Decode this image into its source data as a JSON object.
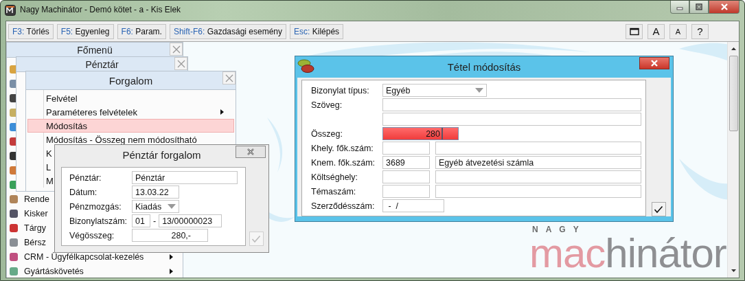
{
  "window": {
    "title": "Nagy Machinátor - Demó kötet - a - Kis Elek"
  },
  "toolbar": {
    "commands": [
      {
        "key": "F3:",
        "label": "Törlés"
      },
      {
        "key": "F5:",
        "label": "Egyenleg"
      },
      {
        "key": "F6:",
        "label": "Param."
      },
      {
        "key": "Shift-F6:",
        "label": "Gazdasági esemény"
      },
      {
        "key": "Esc:",
        "label": "Kilépés"
      }
    ],
    "view_buttons": [
      {
        "kind": "window"
      },
      {
        "kind": "large",
        "label": "A"
      },
      {
        "kind": "small",
        "label": "A"
      },
      {
        "kind": "large",
        "label": "?"
      }
    ]
  },
  "main_menu": {
    "title": "Főmenü",
    "items": [
      {
        "label": "Rende"
      },
      {
        "label": "Kisker"
      },
      {
        "label": "Tárgy"
      },
      {
        "label": "Bérsz"
      },
      {
        "label": "CRM - Ügyfélkapcsolat-kezelés",
        "has_submenu": true
      },
      {
        "label": "Gyártáskövetés",
        "has_submenu": true
      }
    ]
  },
  "cash_menu": {
    "title": "Pénztár"
  },
  "transactions_menu": {
    "title": "Forgalom",
    "items": [
      {
        "label": "Felvétel",
        "has_submenu": false,
        "selected": false
      },
      {
        "label": "Paraméteres felvételek",
        "has_submenu": true,
        "selected": false
      },
      {
        "label": "Módosítás",
        "has_submenu": false,
        "selected": true
      },
      {
        "label": "Módosítás - Összeg nem módosítható",
        "has_submenu": false,
        "selected": false
      },
      {
        "label": "K",
        "selected": false
      },
      {
        "label": "L",
        "selected": false
      },
      {
        "label": "M",
        "selected": false
      }
    ]
  },
  "cash_dialog": {
    "title": "Pénztár forgalom",
    "ok_disabled": true,
    "fields": [
      {
        "label": "Pénztár:",
        "kind": "text",
        "value": "Pénztár"
      },
      {
        "label": "Dátum:",
        "kind": "date",
        "value": "13.03.22"
      },
      {
        "label": "Pénzmozgás:",
        "kind": "combo",
        "value": "Kiadás"
      },
      {
        "label": "Bizonylatszám:",
        "kind": "pair",
        "value": "01",
        "separator": "-",
        "second": "13/00000023"
      },
      {
        "label": "Végösszeg:",
        "kind": "amount",
        "value": "280,-"
      }
    ]
  },
  "item_dialog": {
    "title": "Tétel módosítás",
    "ok_disabled": false,
    "fields": [
      {
        "label": "Bizonylat típus:",
        "kind": "combo",
        "value": "Egyéb",
        "invalid": false
      },
      {
        "label": "Szöveg:",
        "kind": "wide",
        "invalid": false
      },
      {
        "kind": "wide",
        "invalid": false
      },
      {
        "label": "Összeg:",
        "kind": "amount",
        "value": "280",
        "invalid": true
      },
      {
        "label": "Khely. fők.szám:",
        "kind": "account",
        "invalid": false
      },
      {
        "label": "Knem. fők.szám:",
        "kind": "account",
        "value": "3689",
        "name": "Egyéb átvezetési számla",
        "invalid": false
      },
      {
        "label": "Költséghely:",
        "kind": "account",
        "invalid": false
      },
      {
        "label": "Témaszám:",
        "kind": "account",
        "invalid": false
      },
      {
        "label": "Szerződésszám:",
        "kind": "short",
        "value": " -  /",
        "invalid": false
      }
    ]
  },
  "logo": {
    "tagline": "NAGY",
    "first_part": "mac",
    "second_part": "hinátor"
  }
}
